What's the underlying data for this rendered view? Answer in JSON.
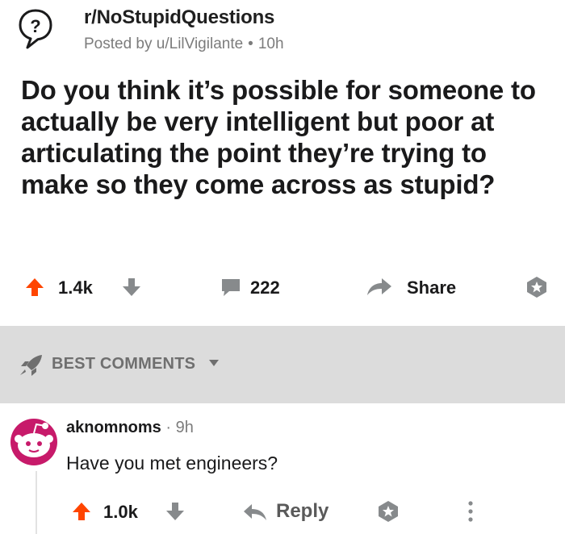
{
  "post": {
    "subreddit": "r/NoStupidQuestions",
    "posted_by": "Posted by u/LilVigilante",
    "separator": "•",
    "age": "10h",
    "title": "Do you think it’s possible for someone to actually be very intelligent but poor at articulating the point they’re trying to make so they come across as stupid?",
    "score": "1.4k",
    "comments": "222",
    "share_label": "Share"
  },
  "sort": {
    "label": "BEST COMMENTS"
  },
  "comment": {
    "author": "aknomnoms",
    "separator": "·",
    "age": "9h",
    "body": "Have you met engineers?",
    "score": "1.0k",
    "reply_label": "Reply",
    "more_label": "⋮"
  },
  "colors": {
    "upvote": "#ff4500",
    "icon_gray": "#878a8c",
    "band": "#dcdcdc",
    "text": "#1a1a1b"
  },
  "icons": {
    "subreddit": "question-mark-bubble-icon",
    "upvote": "upvote-arrow-icon",
    "downvote": "downvote-arrow-icon",
    "comment": "comment-bubble-icon",
    "share": "share-arrow-icon",
    "award": "award-icon",
    "sort": "rocket-icon",
    "reply": "reply-arrow-icon",
    "more": "more-dots-icon"
  }
}
